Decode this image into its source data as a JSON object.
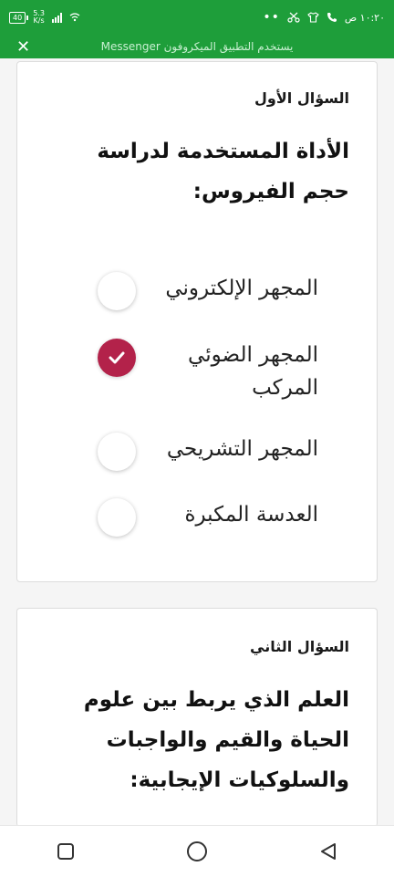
{
  "status_bar": {
    "time": "١٠:٢٠ ص",
    "battery": "40",
    "net_speed_value": "5.3",
    "net_speed_unit": "K/s"
  },
  "banner": {
    "text": "يستخدم التطبيق الميكروفون Messenger",
    "close_icon": "close-icon"
  },
  "question1": {
    "label": "السؤال الأول",
    "text": "الأداة المستخدمة لدراسة حجم الفيروس:",
    "options": [
      {
        "label": "المجهر الإلكتروني",
        "selected": false
      },
      {
        "label": "المجهر الضوئي المركب",
        "selected": true
      },
      {
        "label": "المجهر التشريحي",
        "selected": false
      },
      {
        "label": "العدسة المكبرة",
        "selected": false
      }
    ]
  },
  "question2": {
    "label": "السؤال الثاني",
    "text": "العلم الذي يربط بين علوم الحياة والقيم والواجبات والسلوكيات الإيجابية:"
  },
  "colors": {
    "status_green": "#1e9e3a",
    "selected_radio": "#b3224a"
  }
}
